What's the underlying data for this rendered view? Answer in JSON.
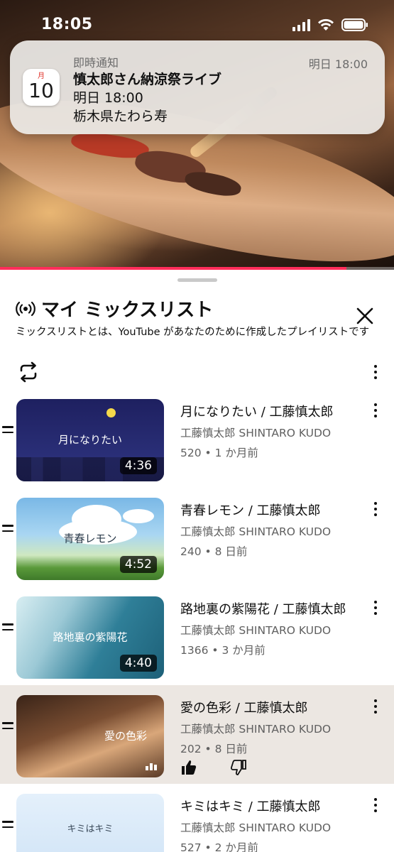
{
  "status_bar": {
    "time": "18:05"
  },
  "notification": {
    "app": "即時通知",
    "time": "明日 18:00",
    "calendar_month": "月",
    "calendar_day": "10",
    "title": "慎太郎さん納涼祭ライブ",
    "line1": "明日 18:00",
    "line2": "栃木県たわら寿"
  },
  "player": {
    "progress_percent": 88,
    "accent": "#ff2d5a"
  },
  "sheet": {
    "title": "マイ ミックスリスト",
    "description": "ミックスリストとは、YouTube があなたのために作成したプレイリストです"
  },
  "playlist": [
    {
      "title": "月になりたい / 工藤慎太郎",
      "channel": "工藤慎太郎 SHINTARO KUDO",
      "meta": "520 • 1 か月前",
      "duration": "4:36",
      "thumb_text": "月になりたい"
    },
    {
      "title": "青春レモン / 工藤慎太郎",
      "channel": "工藤慎太郎 SHINTARO KUDO",
      "meta": "240 • 8 日前",
      "duration": "4:52",
      "thumb_text": "青春レモン"
    },
    {
      "title": "路地裏の紫陽花 / 工藤慎太郎",
      "channel": "工藤慎太郎 SHINTARO KUDO",
      "meta": "1366 • 3 か月前",
      "duration": "4:40",
      "thumb_text": "路地裏の紫陽花"
    },
    {
      "title": "愛の色彩 / 工藤慎太郎",
      "channel": "工藤慎太郎 SHINTARO KUDO",
      "meta": "202 • 8 日前",
      "duration": "",
      "thumb_text": "愛の色彩",
      "playing": true
    },
    {
      "title": "キミはキミ / 工藤慎太郎",
      "channel": "工藤慎太郎 SHINTARO KUDO",
      "meta": "527 • 2 か月前",
      "duration": "",
      "thumb_text": "キミはキミ"
    }
  ],
  "icons": {
    "broadcast": "broadcast-icon",
    "close": "close-icon",
    "loop": "loop-icon",
    "more": "more-vert-icon",
    "drag": "drag-handle-icon",
    "like": "thumb-up-icon",
    "dislike": "thumb-down-icon",
    "playing": "now-playing-icon"
  }
}
